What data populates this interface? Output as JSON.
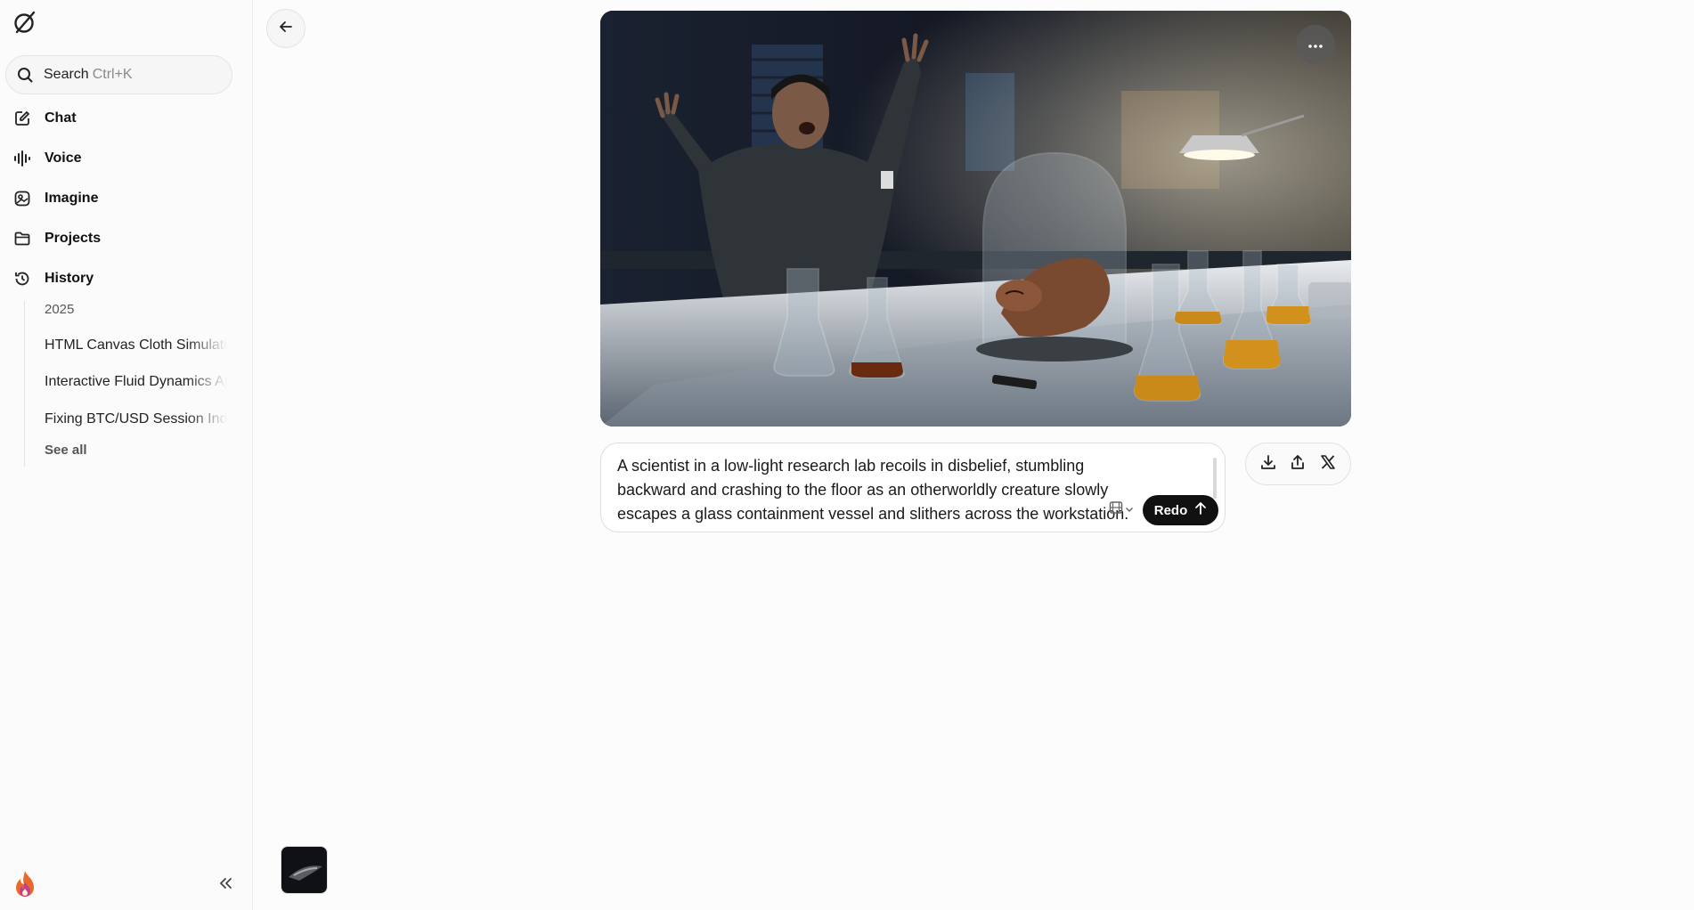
{
  "sidebar": {
    "logo_icon": "grok-logo-icon",
    "search": {
      "label": "Search",
      "shortcut": "Ctrl+K",
      "icon": "search-icon"
    },
    "nav": [
      {
        "label": "Chat",
        "icon": "edit-icon"
      },
      {
        "label": "Voice",
        "icon": "waveform-icon"
      },
      {
        "label": "Imagine",
        "icon": "imagine-icon"
      },
      {
        "label": "Projects",
        "icon": "folder-icon"
      },
      {
        "label": "History",
        "icon": "history-icon"
      }
    ],
    "history": {
      "year": "2025",
      "items": [
        "HTML Canvas Cloth Simulation",
        "Interactive Fluid Dynamics App",
        "Fixing BTC/USD Session Indicator"
      ],
      "see_all": "See all"
    },
    "collapse_icon": "double-chevron-left-icon"
  },
  "main": {
    "back_icon": "arrow-left-icon",
    "image": {
      "alt": "A scientist in a low-light research lab recoils in disbelief as a creature escapes a glass containment vessel",
      "more_icon": "ellipsis-icon"
    },
    "prompt": {
      "text": "A scientist in a low-light research lab recoils in disbelief, stumbling backward and crashing to the floor as an otherworldly creature slowly escapes a glass containment vessel and slithers across the workstation.",
      "mode_icon": "video-mode-icon",
      "redo_label": "Redo"
    },
    "actions": [
      {
        "name": "download",
        "icon": "download-icon"
      },
      {
        "name": "share",
        "icon": "share-icon"
      },
      {
        "name": "post-to-x",
        "icon": "x-logo-icon"
      }
    ]
  },
  "colors": {
    "background": "#fcfcfc",
    "sidebar": "#fbfbfb",
    "accent_button": "#111111",
    "amber_liquid": "#c98a1a"
  }
}
